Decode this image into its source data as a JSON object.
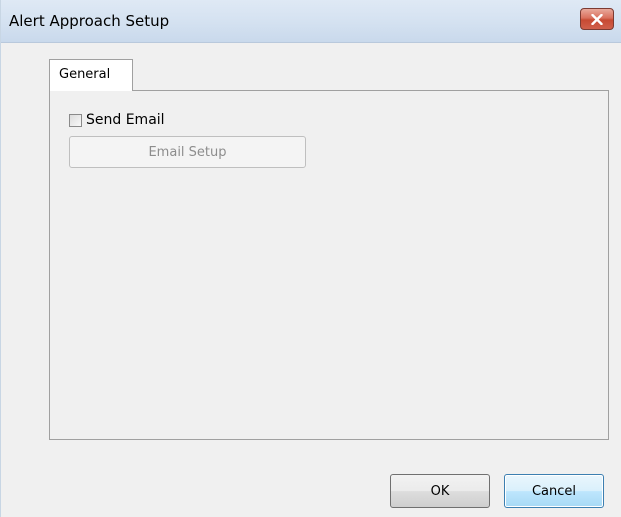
{
  "window": {
    "title": "Alert Approach Setup",
    "close_icon": "close-icon"
  },
  "tabs": [
    {
      "label": "General",
      "selected": true
    }
  ],
  "general": {
    "send_email": {
      "label": "Send Email",
      "checked": false
    },
    "email_setup_button": {
      "label": "Email Setup",
      "enabled": false
    }
  },
  "footer": {
    "ok_label": "OK",
    "cancel_label": "Cancel"
  },
  "colors": {
    "titlebar": "#d5e2f1",
    "close_button": "#c74a33",
    "dialog_background": "#f0f0f0",
    "disabled_text": "#8d8d8d",
    "focused_button_border": "#3c7fb1"
  }
}
